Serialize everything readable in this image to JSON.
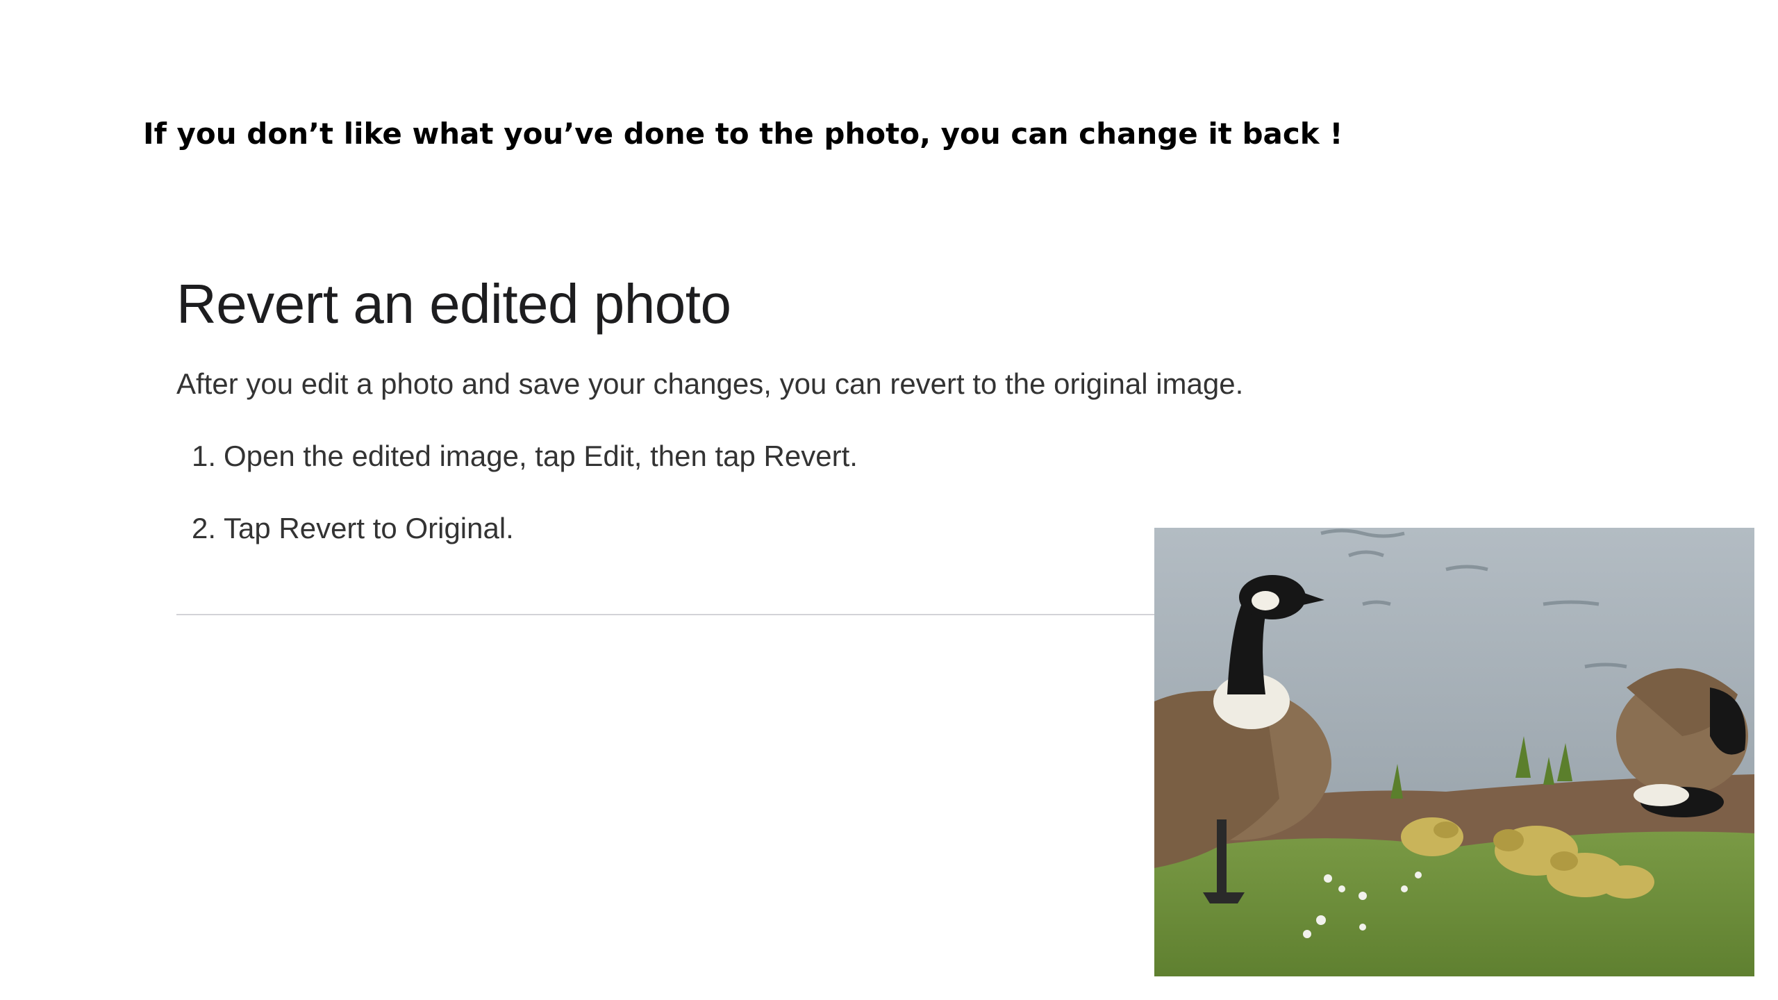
{
  "slide": {
    "caption": "If you don’t like what you’ve done to the photo, you can change it back !"
  },
  "article": {
    "title": "Revert an edited photo",
    "intro": "After you edit a photo and save your changes, you can revert to the original image.",
    "steps": [
      {
        "number": "1.",
        "text": "Open the edited image, tap Edit, then tap Revert."
      },
      {
        "number": "2.",
        "text": "Tap Revert to Original."
      }
    ]
  },
  "photo": {
    "subject": "canada-geese-with-goslings",
    "colors": {
      "water": "#a7b0b7",
      "grass": "#6f8f3a",
      "goose_body": "#8a6f52",
      "goose_neck": "#1a1a1a",
      "goose_cheek": "#f2efe6",
      "gosling": "#c9b45a"
    }
  }
}
